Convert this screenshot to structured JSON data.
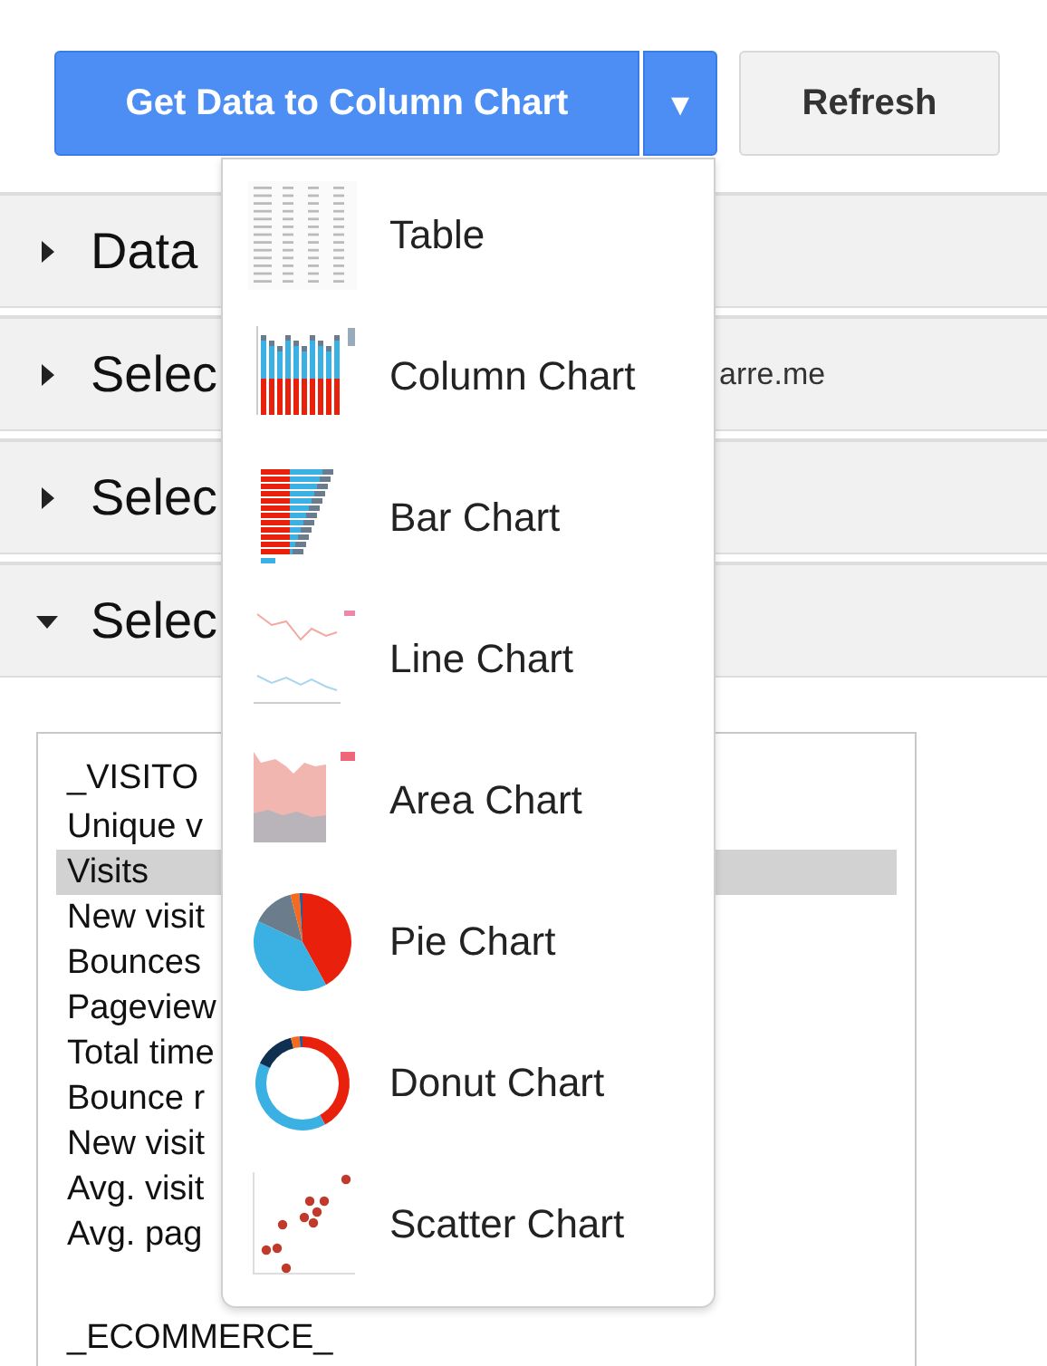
{
  "toolbar": {
    "primary_button": "Get Data to Column Chart",
    "menu_caret": "▾",
    "refresh_button": "Refresh"
  },
  "sections": [
    {
      "title": "Data",
      "expanded": false
    },
    {
      "title": "Selec",
      "expanded": false,
      "value": "arre.me"
    },
    {
      "title": "Selec",
      "expanded": false
    },
    {
      "title": "Selec",
      "expanded": true
    }
  ],
  "metric_list": {
    "groups": [
      {
        "heading": "_VISITO",
        "items": [
          {
            "label": "Unique v",
            "selected": false
          },
          {
            "label": "Visits",
            "selected": true
          },
          {
            "label": "New visit",
            "selected": false
          },
          {
            "label": "Bounces",
            "selected": false
          },
          {
            "label": "Pageview",
            "selected": false
          },
          {
            "label": "Total time",
            "selected": false
          },
          {
            "label": "Bounce r",
            "selected": false
          },
          {
            "label": "New visit",
            "selected": false
          },
          {
            "label": "Avg. visit",
            "selected": false
          },
          {
            "label": "Avg. pag",
            "selected": false
          }
        ]
      },
      {
        "heading": "_ECOMMERCE_"
      }
    ]
  },
  "chart_menu": {
    "items": [
      {
        "label": "Table",
        "kind": "table"
      },
      {
        "label": "Column Chart",
        "kind": "column"
      },
      {
        "label": "Bar Chart",
        "kind": "bar"
      },
      {
        "label": "Line Chart",
        "kind": "line"
      },
      {
        "label": "Area Chart",
        "kind": "area"
      },
      {
        "label": "Pie Chart",
        "kind": "pie"
      },
      {
        "label": "Donut Chart",
        "kind": "donut"
      },
      {
        "label": "Scatter Chart",
        "kind": "scatter"
      }
    ]
  }
}
